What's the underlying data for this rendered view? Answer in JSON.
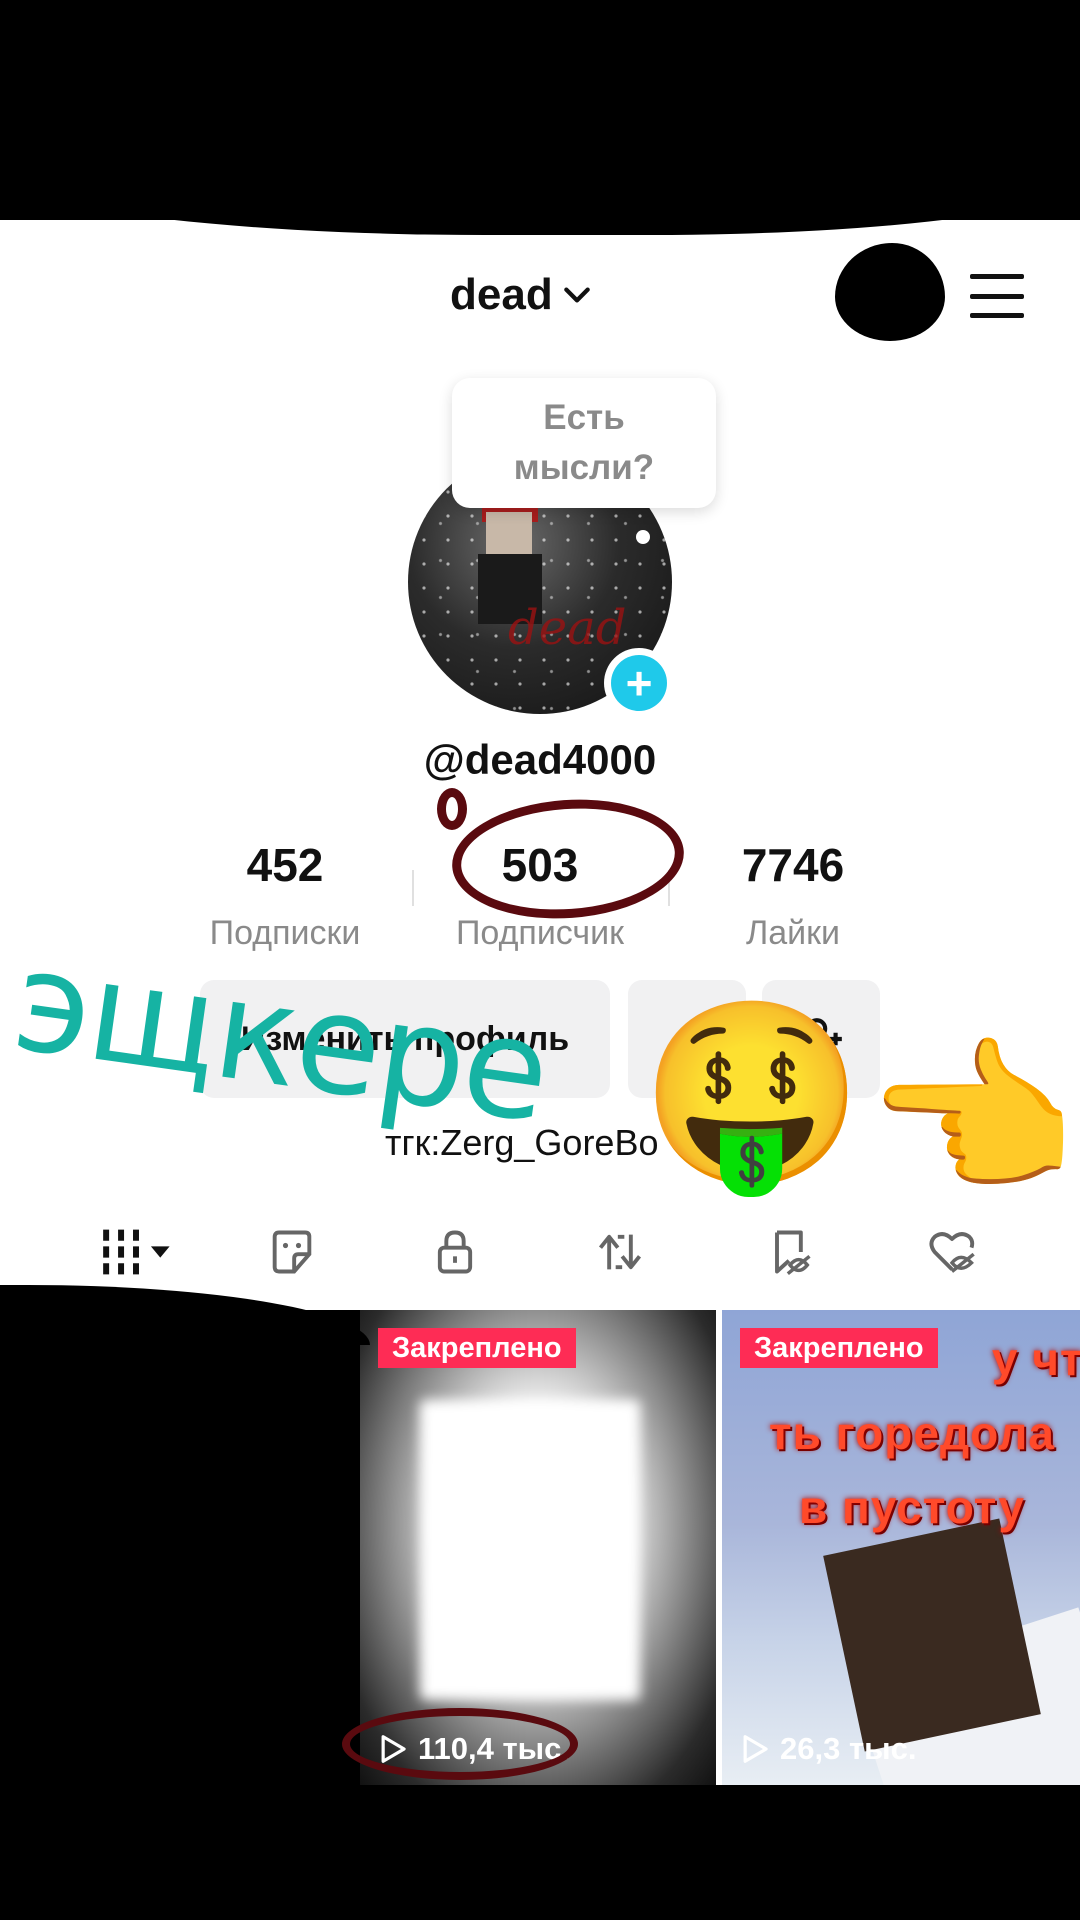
{
  "header": {
    "account_name": "dead"
  },
  "bubble": {
    "line1": "Есть",
    "line2": "мысли?"
  },
  "profile": {
    "username": "@dead4000",
    "avatar_text": "dead"
  },
  "stats": [
    {
      "value": "452",
      "label": "Подписки"
    },
    {
      "value": "503",
      "label": "Подписчик"
    },
    {
      "value": "7746",
      "label": "Лайки"
    }
  ],
  "actions": {
    "edit_label": "Изменить профиль"
  },
  "bio": "тгк:Zerg_GoreBo",
  "tabs": [
    "videos-grid",
    "sticker",
    "lock",
    "repost",
    "bookmark-hidden",
    "liked-hidden"
  ],
  "videos": [
    {
      "pinned_label": "Закреплено",
      "views": "110,4 тыс."
    },
    {
      "pinned_label": "Закреплено",
      "caption": "у что ть горедола в пустоту",
      "caption_lines": [
        "у что",
        "ть горедола",
        "в пустоту"
      ],
      "views": "26,3 тыс."
    }
  ],
  "overlay": {
    "word": "эщкере",
    "emoji_money": "🤑",
    "emoji_point": "👈"
  },
  "colors": {
    "accent_cyan": "#1fc9ea",
    "pin_red": "#fe2c55",
    "overlay_teal": "#16b3a3",
    "marker": "#5a0a0f"
  }
}
